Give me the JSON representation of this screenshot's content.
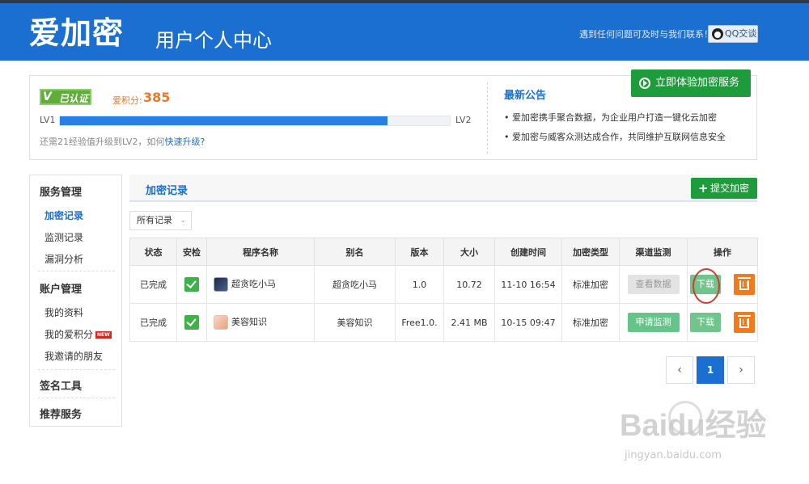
{
  "header": {
    "logo_text": "爱加密",
    "subtitle": "用户个人中心",
    "help_text": "遇到任何问题可及时与我们联系！",
    "qq_label": "QQ交谈"
  },
  "profile": {
    "verified_label": "已认证",
    "points_label": "爱积分:",
    "points_value": "385",
    "level_from": "LV1",
    "level_to": "LV2",
    "progress_fraction": 0.84,
    "upgrade_tip": "还需21经验值升级到LV2，如何",
    "upgrade_link": "快速升级?",
    "try_button": "立即体验加密服务"
  },
  "notice": {
    "title": "最新公告",
    "items": [
      "爱加密携手聚合数据，为企业用户打造一键化云加密",
      "爱加密与威客众测达成合作，共同维护互联网信息安全"
    ]
  },
  "sidebar": {
    "group1_title": "服务管理",
    "group1_items": [
      "加密记录",
      "监测记录",
      "漏洞分析"
    ],
    "group2_title": "账户管理",
    "group2_items": [
      "我的资料",
      "我的爱积分",
      "我邀请的朋友"
    ],
    "new_badge": "NEW",
    "group3_title": "签名工具",
    "group4_title": "推荐服务"
  },
  "main": {
    "title": "加密记录",
    "submit_button": "提交加密",
    "filter_value": "所有记录"
  },
  "table": {
    "columns": [
      "状态",
      "安检",
      "程序名称",
      "别名",
      "版本",
      "大小",
      "创建时间",
      "加密类型",
      "渠道监测",
      "操作"
    ],
    "rows": [
      {
        "status": "已完成",
        "program": "超贪吃小马",
        "alias": "超贪吃小马",
        "version": "1.0",
        "size": "10.72",
        "created": "11-10 16:54",
        "type": "标准加密",
        "channel_action": "查看数据",
        "download": "下载"
      },
      {
        "status": "已完成",
        "program": "美容知识",
        "alias": "美容知识",
        "version": "Free1.0.",
        "size": "2.41 MB",
        "created": "10-15 09:47",
        "type": "标准加密",
        "channel_action": "申请监测",
        "download": "下载"
      }
    ]
  },
  "pagination": {
    "prev": "‹",
    "current": "1",
    "next": "›"
  },
  "watermark": {
    "brand": "Baidu经验",
    "url": "jingyan.baidu.com"
  },
  "colors": {
    "brand_blue": "#1a6fd1",
    "green": "#1e9b3a",
    "orange": "#f07a1c",
    "points": "#e9792b"
  }
}
